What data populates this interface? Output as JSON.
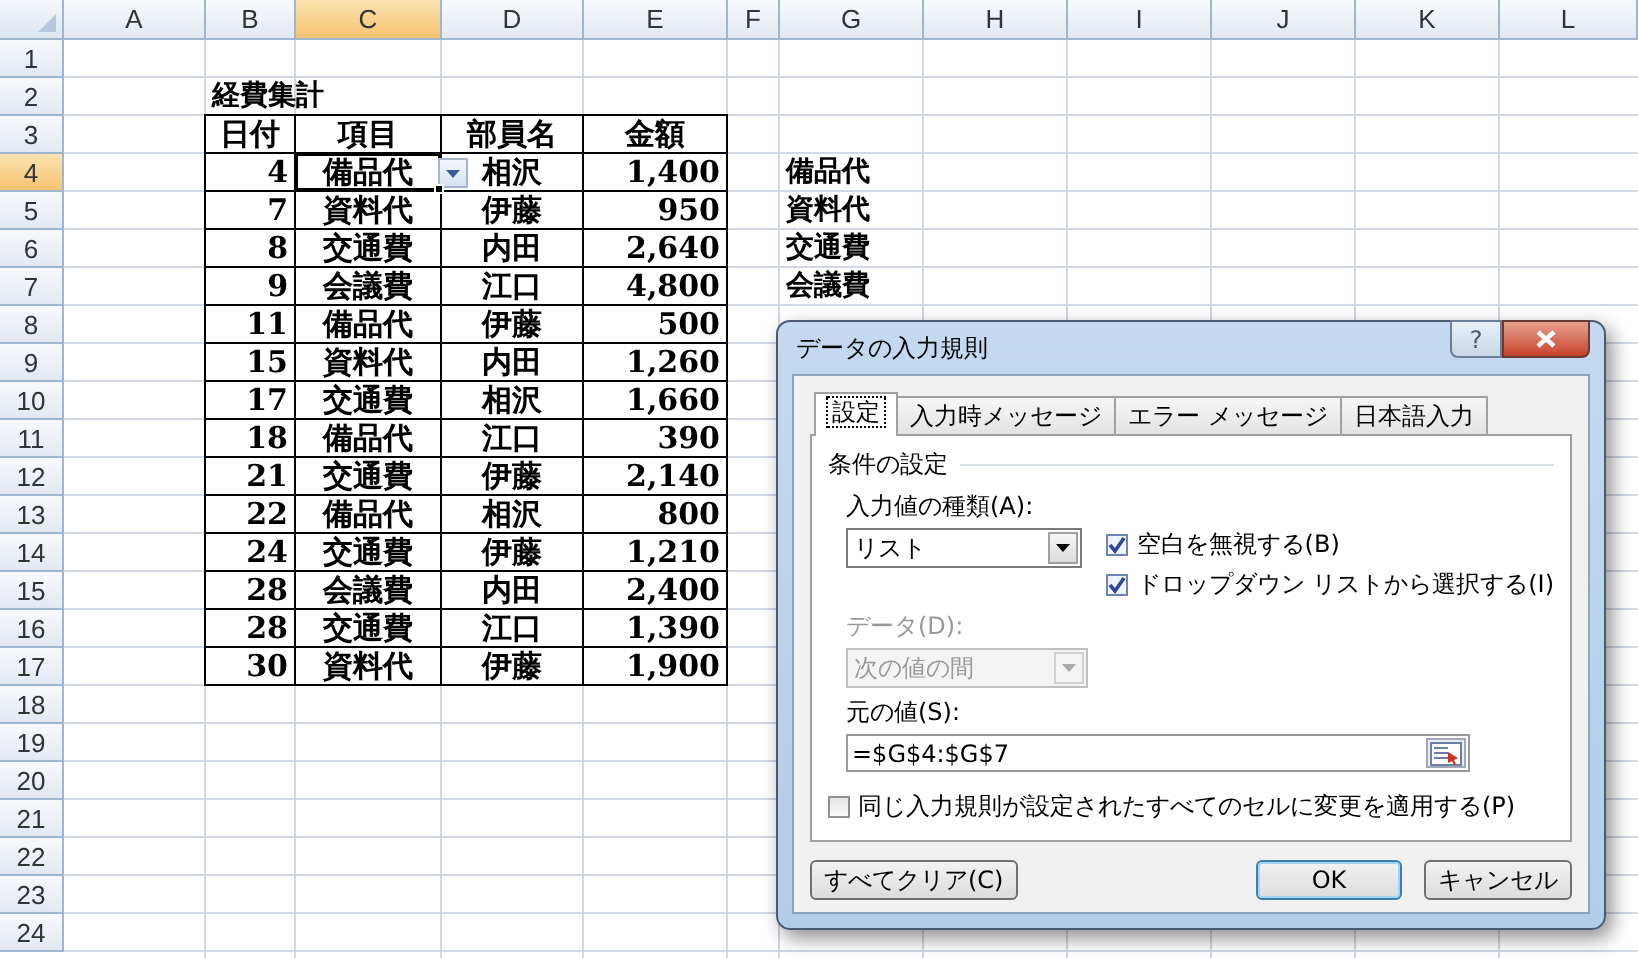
{
  "sheet": {
    "columns": [
      {
        "label": "A",
        "selected": false
      },
      {
        "label": "B",
        "selected": false
      },
      {
        "label": "C",
        "selected": true
      },
      {
        "label": "D",
        "selected": false
      },
      {
        "label": "E",
        "selected": false
      },
      {
        "label": "F",
        "selected": false
      },
      {
        "label": "G",
        "selected": false
      },
      {
        "label": "H",
        "selected": false
      },
      {
        "label": "I",
        "selected": false
      },
      {
        "label": "J",
        "selected": false
      },
      {
        "label": "K",
        "selected": false
      },
      {
        "label": "L",
        "selected": false
      }
    ],
    "rows": [
      {
        "label": "1",
        "selected": false
      },
      {
        "label": "2",
        "selected": false
      },
      {
        "label": "3",
        "selected": false
      },
      {
        "label": "4",
        "selected": true
      },
      {
        "label": "5",
        "selected": false
      },
      {
        "label": "6",
        "selected": false
      },
      {
        "label": "7",
        "selected": false
      },
      {
        "label": "8",
        "selected": false
      },
      {
        "label": "9",
        "selected": false
      },
      {
        "label": "10",
        "selected": false
      },
      {
        "label": "11",
        "selected": false
      },
      {
        "label": "12",
        "selected": false
      },
      {
        "label": "13",
        "selected": false
      },
      {
        "label": "14",
        "selected": false
      },
      {
        "label": "15",
        "selected": false
      },
      {
        "label": "16",
        "selected": false
      },
      {
        "label": "17",
        "selected": false
      },
      {
        "label": "18",
        "selected": false
      },
      {
        "label": "19",
        "selected": false
      },
      {
        "label": "20",
        "selected": false
      },
      {
        "label": "21",
        "selected": false
      },
      {
        "label": "22",
        "selected": false
      },
      {
        "label": "23",
        "selected": false
      },
      {
        "label": "24",
        "selected": false
      }
    ],
    "title": "経費集計",
    "table": {
      "header": [
        "日付",
        "項目",
        "部員名",
        "金額"
      ],
      "rows": [
        {
          "cells": [
            {
              "text": "4",
              "selected": false
            },
            {
              "text": "備品代",
              "selected": true
            },
            {
              "text": "相沢",
              "selected": false
            },
            {
              "text": "1,400",
              "selected": false
            }
          ]
        },
        {
          "cells": [
            {
              "text": "7",
              "selected": false
            },
            {
              "text": "資料代",
              "selected": false
            },
            {
              "text": "伊藤",
              "selected": false
            },
            {
              "text": "950",
              "selected": false
            }
          ]
        },
        {
          "cells": [
            {
              "text": "8",
              "selected": false
            },
            {
              "text": "交通費",
              "selected": false
            },
            {
              "text": "内田",
              "selected": false
            },
            {
              "text": "2,640",
              "selected": false
            }
          ]
        },
        {
          "cells": [
            {
              "text": "9",
              "selected": false
            },
            {
              "text": "会議費",
              "selected": false
            },
            {
              "text": "江口",
              "selected": false
            },
            {
              "text": "4,800",
              "selected": false
            }
          ]
        },
        {
          "cells": [
            {
              "text": "11",
              "selected": false
            },
            {
              "text": "備品代",
              "selected": false
            },
            {
              "text": "伊藤",
              "selected": false
            },
            {
              "text": "500",
              "selected": false
            }
          ]
        },
        {
          "cells": [
            {
              "text": "15",
              "selected": false
            },
            {
              "text": "資料代",
              "selected": false
            },
            {
              "text": "内田",
              "selected": false
            },
            {
              "text": "1,260",
              "selected": false
            }
          ]
        },
        {
          "cells": [
            {
              "text": "17",
              "selected": false
            },
            {
              "text": "交通費",
              "selected": false
            },
            {
              "text": "相沢",
              "selected": false
            },
            {
              "text": "1,660",
              "selected": false
            }
          ]
        },
        {
          "cells": [
            {
              "text": "18",
              "selected": false
            },
            {
              "text": "備品代",
              "selected": false
            },
            {
              "text": "江口",
              "selected": false
            },
            {
              "text": "390",
              "selected": false
            }
          ]
        },
        {
          "cells": [
            {
              "text": "21",
              "selected": false
            },
            {
              "text": "交通費",
              "selected": false
            },
            {
              "text": "伊藤",
              "selected": false
            },
            {
              "text": "2,140",
              "selected": false
            }
          ]
        },
        {
          "cells": [
            {
              "text": "22",
              "selected": false
            },
            {
              "text": "備品代",
              "selected": false
            },
            {
              "text": "相沢",
              "selected": false
            },
            {
              "text": "800",
              "selected": false
            }
          ]
        },
        {
          "cells": [
            {
              "text": "24",
              "selected": false
            },
            {
              "text": "交通費",
              "selected": false
            },
            {
              "text": "伊藤",
              "selected": false
            },
            {
              "text": "1,210",
              "selected": false
            }
          ]
        },
        {
          "cells": [
            {
              "text": "28",
              "selected": false
            },
            {
              "text": "会議費",
              "selected": false
            },
            {
              "text": "内田",
              "selected": false
            },
            {
              "text": "2,400",
              "selected": false
            }
          ]
        },
        {
          "cells": [
            {
              "text": "28",
              "selected": false
            },
            {
              "text": "交通費",
              "selected": false
            },
            {
              "text": "江口",
              "selected": false
            },
            {
              "text": "1,390",
              "selected": false
            }
          ]
        },
        {
          "cells": [
            {
              "text": "30",
              "selected": false
            },
            {
              "text": "資料代",
              "selected": false
            },
            {
              "text": "伊藤",
              "selected": false
            },
            {
              "text": "1,900",
              "selected": false
            }
          ]
        }
      ]
    },
    "list_values": [
      "備品代",
      "資料代",
      "交通費",
      "会議費"
    ]
  },
  "dialog": {
    "title": "データの入力規則",
    "help_button": "?",
    "tabs": [
      {
        "label": "設定",
        "selected": true
      },
      {
        "label": "入力時メッセージ",
        "selected": false
      },
      {
        "label": "エラー メッセージ",
        "selected": false
      },
      {
        "label": "日本語入力",
        "selected": false
      }
    ],
    "group_label": "条件の設定",
    "allow": {
      "label": "入力値の種類(A):",
      "value": "リスト",
      "disabled": false
    },
    "options": [
      {
        "label": "空白を無視する(B)",
        "checked": true
      },
      {
        "label": "ドロップダウン リストから選択する(I)",
        "checked": true
      }
    ],
    "data": {
      "label": "データ(D):",
      "value": "次の値の間",
      "disabled": true
    },
    "source": {
      "label": "元の値(S):",
      "value": "=$G$4:$G$7"
    },
    "apply_all": {
      "label": "同じ入力規則が設定されたすべてのセルに変更を適用する(P)",
      "checked": false
    },
    "buttons": [
      {
        "label": "すべてクリア(C)",
        "is_default": false
      },
      {
        "label": "OK",
        "is_default": true
      },
      {
        "label": "キャンセル",
        "is_default": false
      }
    ]
  }
}
